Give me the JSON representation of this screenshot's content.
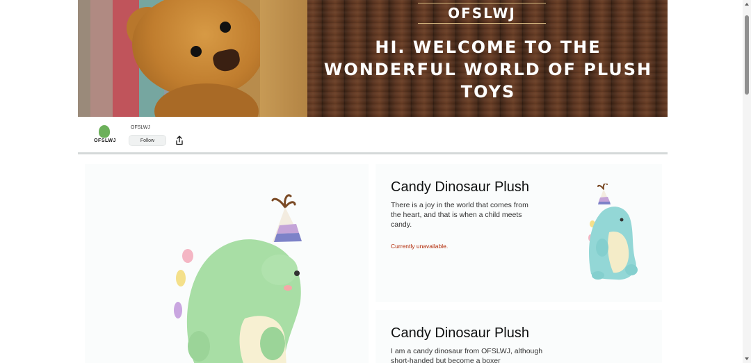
{
  "hero": {
    "brand": "OFSLWJ",
    "headline": "Hi. Welcome to the wonderful world of plush toys"
  },
  "store": {
    "logo_text": "OFSLWJ",
    "name": "OFSLWJ",
    "follow_label": "Follow",
    "share_icon": "share-icon"
  },
  "products": [
    {
      "title": "Candy Dinosaur Plush",
      "description": "There is a joy in the world that comes from the heart, and that is when a child meets candy.",
      "status": "Currently unavailable."
    },
    {
      "title": "Candy Dinosaur Plush",
      "description": "I am a candy dinosaur from OFSLWJ, although short-handed but become a boxer"
    }
  ],
  "colors": {
    "status_red": "#b12704",
    "card_bg": "#fafcfc",
    "divider": "#d5d9d9"
  }
}
